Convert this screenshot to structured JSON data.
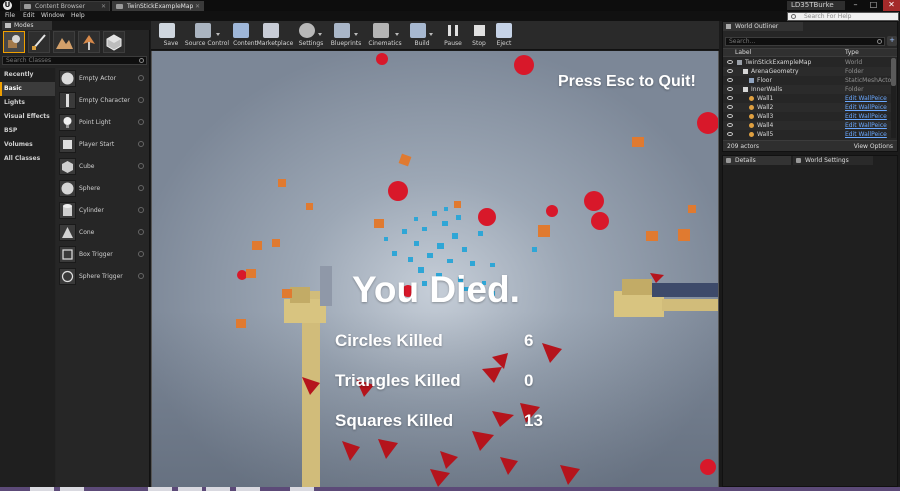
{
  "window": {
    "tabs": [
      {
        "label": "Content Browser",
        "active": false
      },
      {
        "label": "TwinStickExampleMap",
        "active": true
      }
    ],
    "user": "LD35TBurke",
    "help_search_placeholder": "Search For Help",
    "controls": {
      "minimize": "–",
      "maximize": "□",
      "close": "✕"
    }
  },
  "menu": {
    "items": [
      "File",
      "Edit",
      "Window",
      "Help"
    ]
  },
  "modes": {
    "tab_label": "Modes",
    "search_placeholder": "Search Classes",
    "categories": [
      {
        "label": "Recently Placed",
        "active": false
      },
      {
        "label": "Basic",
        "active": true
      },
      {
        "label": "Lights",
        "active": false
      },
      {
        "label": "Visual Effects",
        "active": false
      },
      {
        "label": "BSP",
        "active": false
      },
      {
        "label": "Volumes",
        "active": false
      },
      {
        "label": "All Classes",
        "active": false
      }
    ],
    "items": [
      {
        "label": "Empty Actor",
        "icon": "sphere-icon"
      },
      {
        "label": "Empty Character",
        "icon": "character-icon"
      },
      {
        "label": "Point Light",
        "icon": "light-icon"
      },
      {
        "label": "Player Start",
        "icon": "player-start-icon"
      },
      {
        "label": "Cube",
        "icon": "cube-icon"
      },
      {
        "label": "Sphere",
        "icon": "sphere-icon"
      },
      {
        "label": "Cylinder",
        "icon": "cylinder-icon"
      },
      {
        "label": "Cone",
        "icon": "cone-icon"
      },
      {
        "label": "Box Trigger",
        "icon": "box-trigger-icon"
      },
      {
        "label": "Sphere Trigger",
        "icon": "sphere-trigger-icon"
      }
    ]
  },
  "toolbar": {
    "buttons": [
      {
        "label": "Save",
        "icon": "save-icon",
        "color": "#cfd6de"
      },
      {
        "label": "Source Control",
        "icon": "source-control-icon",
        "color": "#aab4c0"
      },
      {
        "label": "Content",
        "icon": "content-icon",
        "color": "#9fb7d9"
      },
      {
        "label": "Marketplace",
        "icon": "marketplace-icon",
        "color": "#c8ccd6"
      },
      {
        "label": "Settings",
        "icon": "settings-icon",
        "color": "#b8b8b8"
      },
      {
        "label": "Blueprints",
        "icon": "blueprints-icon",
        "color": "#a9b6c8"
      },
      {
        "label": "Cinematics",
        "icon": "cinematics-icon",
        "color": "#b5b5b5"
      },
      {
        "label": "Build",
        "icon": "build-icon",
        "color": "#a7b8d0"
      },
      {
        "label": "Pause",
        "icon": "pause-icon",
        "color": "#e0e0e0"
      },
      {
        "label": "Stop",
        "icon": "stop-icon",
        "color": "#e0e0e0"
      },
      {
        "label": "Eject",
        "icon": "eject-icon",
        "color": "#c5d2e6"
      }
    ]
  },
  "viewport": {
    "quit_hint": "Press Esc to Quit!",
    "game_over_title": "You Died.",
    "stats": [
      {
        "label": "Circles Killed",
        "value": "6"
      },
      {
        "label": "Triangles Killed",
        "value": "0"
      },
      {
        "label": "Squares Killed",
        "value": "13"
      }
    ],
    "colors": {
      "enemy_circle": "#d8182a",
      "enemy_triangle": "#b5141c",
      "enemy_square": "#e07a30",
      "debris": "#2fa6d6",
      "turret": "#d8c07a"
    }
  },
  "outliner": {
    "tab_label": "World Outliner",
    "search_placeholder": "Search...",
    "columns": {
      "label": "Label",
      "type": "Type"
    },
    "rows": [
      {
        "name": "TwinStickExampleMap",
        "type": "World",
        "level": 0,
        "kind": "world",
        "link": false
      },
      {
        "name": "ArenaGeometry",
        "type": "Folder",
        "level": 1,
        "kind": "folder",
        "link": false
      },
      {
        "name": "Floor",
        "type": "StaticMeshActor",
        "level": 2,
        "kind": "actor",
        "link": false
      },
      {
        "name": "InnerWalls",
        "type": "Folder",
        "level": 1,
        "kind": "folder",
        "link": false
      },
      {
        "name": "Wall1",
        "type": "Edit WallPeice",
        "level": 2,
        "kind": "actor",
        "link": true
      },
      {
        "name": "Wall2",
        "type": "Edit WallPeice",
        "level": 2,
        "kind": "actor",
        "link": true
      },
      {
        "name": "Wall3",
        "type": "Edit WallPeice",
        "level": 2,
        "kind": "actor",
        "link": true
      },
      {
        "name": "Wall4",
        "type": "Edit WallPeice",
        "level": 2,
        "kind": "actor",
        "link": true
      },
      {
        "name": "Wall5",
        "type": "Edit WallPeice",
        "level": 2,
        "kind": "actor",
        "link": true
      }
    ],
    "actor_count": "209 actors",
    "view_options": "View Options"
  },
  "details": {
    "tabs": [
      {
        "label": "Details"
      },
      {
        "label": "World Settings"
      }
    ]
  }
}
